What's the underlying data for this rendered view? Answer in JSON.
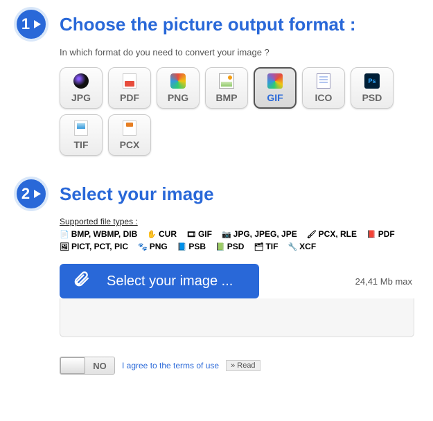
{
  "step1": {
    "num": "1",
    "title": "Choose the picture output format :",
    "subtitle": "In which format do you need to convert your image ?"
  },
  "formats": [
    {
      "label": "JPG",
      "icon": "jpg",
      "selected": false
    },
    {
      "label": "PDF",
      "icon": "pdf",
      "selected": false
    },
    {
      "label": "PNG",
      "icon": "png",
      "selected": false
    },
    {
      "label": "BMP",
      "icon": "bmp",
      "selected": false
    },
    {
      "label": "GIF",
      "icon": "gif",
      "selected": true
    },
    {
      "label": "ICO",
      "icon": "ico",
      "selected": false
    },
    {
      "label": "PSD",
      "icon": "psd",
      "selected": false
    },
    {
      "label": "TIF",
      "icon": "tif",
      "selected": false
    },
    {
      "label": "PCX",
      "icon": "pcx",
      "selected": false
    }
  ],
  "step2": {
    "num": "2",
    "title": "Select your image",
    "supported_title": "Supported file types :",
    "supported": [
      "BMP, WBMP, DIB",
      "CUR",
      "GIF",
      "JPG, JPEG, JPE",
      "PCX, RLE",
      "PDF",
      "PICT, PCT, PIC",
      "PNG",
      "PSB",
      "PSD",
      "TIF",
      "XCF"
    ],
    "upload_label": "Select your image ...",
    "max_label": "24,41 Mb max"
  },
  "terms": {
    "toggle_state": "NO",
    "link_text": "I agree to the terms of use",
    "read_label": "» Read"
  }
}
